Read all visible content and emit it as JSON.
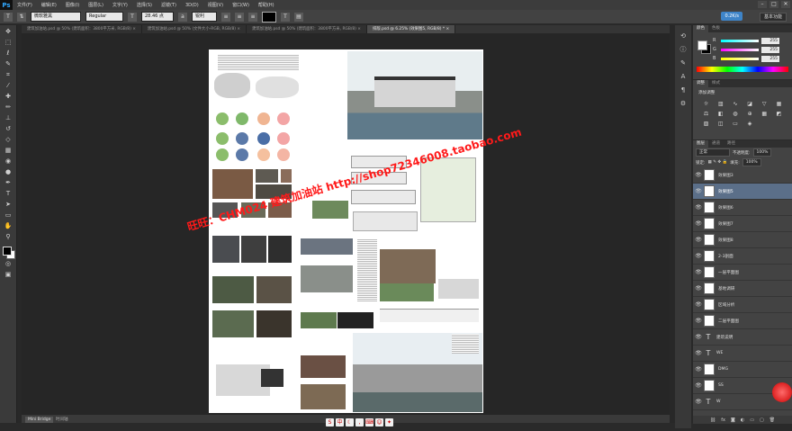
{
  "app": {
    "logo": "Ps"
  },
  "menu": [
    "文件(F)",
    "编辑(E)",
    "图像(I)",
    "图层(L)",
    "文字(Y)",
    "选择(S)",
    "滤镜(T)",
    "3D(D)",
    "视图(V)",
    "窗口(W)",
    "帮助(H)"
  ],
  "window_controls": {
    "minimize": "–",
    "maximize": "□",
    "close": "✕"
  },
  "options": {
    "font_family": "微软雅黑",
    "font_style": "Regular",
    "font_size": "28.46 点",
    "antialias": "锐利",
    "speed_badge": "0.2K/s",
    "workspace": "基本功能"
  },
  "tabs": [
    {
      "label": "建筑加油站.psd @ 50% (建筑面积：3800平方米, RGB/8) ×",
      "active": false
    },
    {
      "label": "建筑加油站.psd @ 50% (文件大小-RGB, RGB/8) ×",
      "active": false
    },
    {
      "label": "建筑加油站.psd @ 50% (建筑面积：3800平方米, RGB/8) ×",
      "active": false
    },
    {
      "label": "排版.psd @ 6.25% (效果图5, RGB/8) * ×",
      "active": true
    }
  ],
  "watermark": "旺旺：CHM024 建筑加油站 http://shop72346008.taobao.com",
  "status": {
    "mini_bridge": "Mini Bridge",
    "timeline": "时间轴"
  },
  "color_panel": {
    "tabs": [
      "颜色",
      "色板"
    ],
    "channels": [
      {
        "label": "R",
        "value": "255"
      },
      {
        "label": "G",
        "value": "255"
      },
      {
        "label": "B",
        "value": "255"
      }
    ],
    "fg_color": "#ffffff",
    "bg_color": "#000000"
  },
  "adjustments_panel": {
    "tabs": [
      "调整",
      "样式"
    ],
    "title": "添加调整"
  },
  "layers_panel": {
    "tabs": [
      "图层",
      "通道",
      "路径"
    ],
    "blend_mode": "正常",
    "opacity_label": "不透明度:",
    "opacity": "100%",
    "lock_label": "锁定:",
    "fill_label": "填充:",
    "fill": "100%",
    "layers": [
      {
        "name": "效果图3",
        "type": "image",
        "selected": false
      },
      {
        "name": "效果图5",
        "type": "image",
        "selected": true
      },
      {
        "name": "效果图6",
        "type": "image",
        "selected": false
      },
      {
        "name": "效果图7",
        "type": "image",
        "selected": false
      },
      {
        "name": "效果图8",
        "type": "image",
        "selected": false
      },
      {
        "name": "2-3剖面",
        "type": "image",
        "selected": false
      },
      {
        "name": "一层平面图",
        "type": "image",
        "selected": false
      },
      {
        "name": "基地调研",
        "type": "image",
        "selected": false
      },
      {
        "name": "区域分析",
        "type": "image",
        "selected": false
      },
      {
        "name": "二层平面图",
        "type": "image",
        "selected": false
      },
      {
        "name": "建筑说明",
        "type": "text",
        "selected": false
      },
      {
        "name": "WE",
        "type": "text",
        "selected": false
      },
      {
        "name": "DMG",
        "type": "image",
        "selected": false
      },
      {
        "name": "SS",
        "type": "image",
        "selected": false
      },
      {
        "name": "W",
        "type": "text",
        "selected": false
      }
    ]
  },
  "tools": [
    "move-tool",
    "marquee-tool",
    "lasso-tool",
    "quick-select-tool",
    "crop-tool",
    "eyedropper-tool",
    "healing-tool",
    "brush-tool",
    "clone-tool",
    "history-brush-tool",
    "eraser-tool",
    "gradient-tool",
    "blur-tool",
    "dodge-tool",
    "pen-tool",
    "type-tool",
    "path-select-tool",
    "shape-tool",
    "hand-tool",
    "zoom-tool"
  ]
}
